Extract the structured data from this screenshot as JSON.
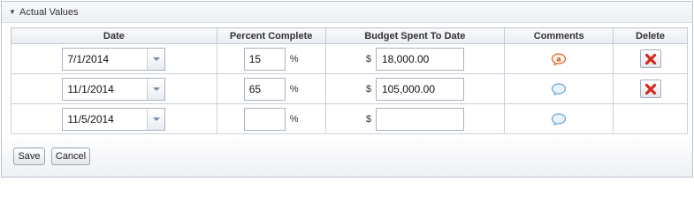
{
  "panel": {
    "title": "Actual Values",
    "toggle_icon": "triangle-down-icon"
  },
  "table": {
    "headers": {
      "date": "Date",
      "percent": "Percent Complete",
      "budget": "Budget Spent To Date",
      "comments": "Comments",
      "delete": "Delete"
    },
    "percent_symbol": "%",
    "currency_symbol": "$",
    "rows": [
      {
        "date": "7/1/2014",
        "percent": "15",
        "budget": "18,000.00",
        "comment_icon": "comment-icon-new",
        "has_delete": true
      },
      {
        "date": "11/1/2014",
        "percent": "65",
        "budget": "105,000.00",
        "comment_icon": "speech-bubble-icon",
        "has_delete": true
      },
      {
        "date": "11/5/2014",
        "percent": "",
        "budget": "",
        "comment_icon": "speech-bubble-icon",
        "has_delete": false
      }
    ]
  },
  "buttons": {
    "save": "Save",
    "cancel": "Cancel"
  },
  "colors": {
    "delete_red": "#d42a1e",
    "comment_orange": "#e0672c",
    "comment_blue": "#6fa6db"
  }
}
